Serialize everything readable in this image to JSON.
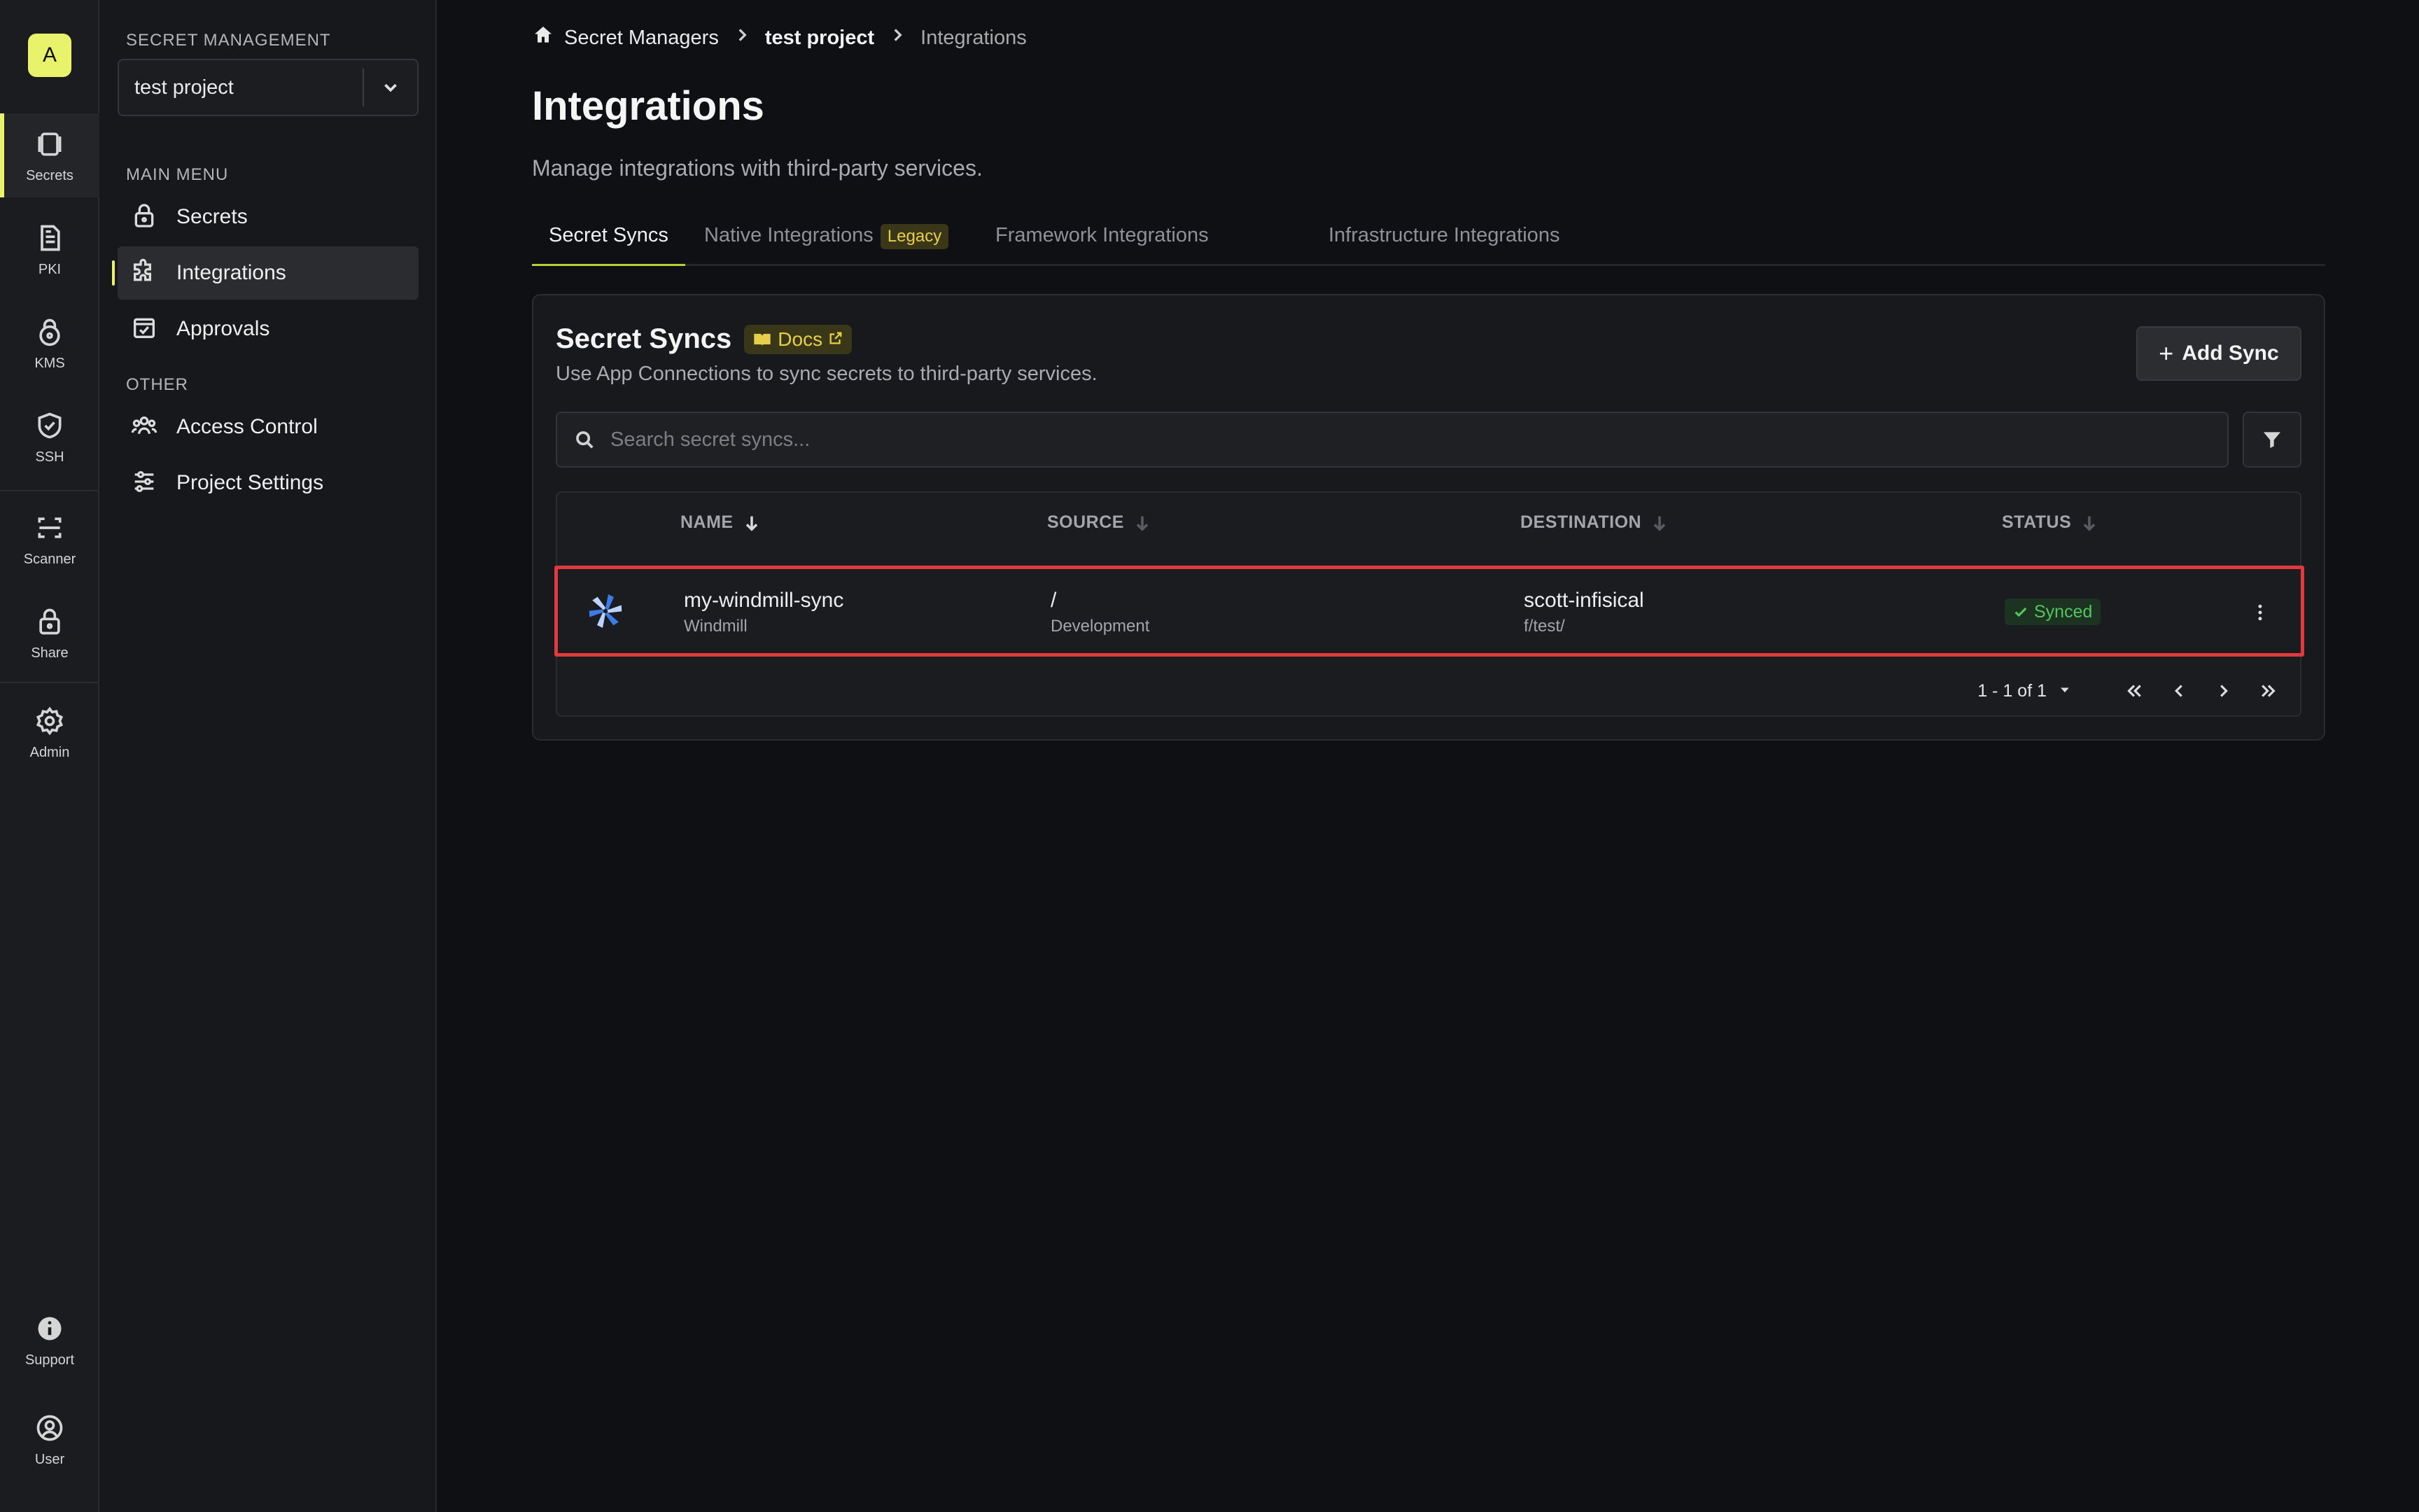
{
  "org": {
    "avatar_letter": "A"
  },
  "rail": {
    "items": [
      {
        "label": "Secrets",
        "icon": "secrets-icon"
      },
      {
        "label": "PKI",
        "icon": "pki-icon"
      },
      {
        "label": "KMS",
        "icon": "kms-icon"
      },
      {
        "label": "SSH",
        "icon": "ssh-icon"
      },
      {
        "label": "Scanner",
        "icon": "scanner-icon"
      },
      {
        "label": "Share",
        "icon": "share-icon"
      },
      {
        "label": "Admin",
        "icon": "gear-icon"
      },
      {
        "label": "Support",
        "icon": "info-icon"
      },
      {
        "label": "User",
        "icon": "user-icon"
      }
    ],
    "active": "Secrets",
    "accent_color": "#e8f26a"
  },
  "sidebar": {
    "section_title": "SECRET MANAGEMENT",
    "project_name": "test project",
    "main_menu_title": "MAIN MENU",
    "main_menu": [
      {
        "label": "Secrets",
        "icon": "lock-icon"
      },
      {
        "label": "Integrations",
        "icon": "puzzle-icon"
      },
      {
        "label": "Approvals",
        "icon": "approval-icon"
      }
    ],
    "other_title": "OTHER",
    "other_menu": [
      {
        "label": "Access Control",
        "icon": "users-icon"
      },
      {
        "label": "Project Settings",
        "icon": "sliders-icon"
      }
    ],
    "active": "Integrations"
  },
  "breadcrumb": {
    "items": [
      "Secret Managers",
      "test project",
      "Integrations"
    ]
  },
  "page": {
    "title": "Integrations",
    "subtitle": "Manage integrations with third-party services."
  },
  "tabs": {
    "items": [
      {
        "label": "Secret Syncs"
      },
      {
        "label": "Native Integrations",
        "badge": "Legacy"
      },
      {
        "label": "Framework Integrations"
      },
      {
        "label": "Infrastructure Integrations"
      }
    ],
    "active": "Secret Syncs"
  },
  "panel": {
    "title": "Secret Syncs",
    "docs_label": "Docs",
    "subtitle": "Use App Connections to sync secrets to third-party services.",
    "add_button": "Add Sync",
    "search_placeholder": "Search secret syncs..."
  },
  "table": {
    "columns": [
      "NAME",
      "SOURCE",
      "DESTINATION",
      "STATUS"
    ],
    "rows": [
      {
        "name": "my-windmill-sync",
        "service": "Windmill",
        "source_path": "/",
        "source_env": "Development",
        "destination": "scott-infisical",
        "destination_path": "f/test/",
        "status": "Synced",
        "logo": "windmill-logo"
      }
    ],
    "pagination": "1 - 1 of 1"
  },
  "colors": {
    "highlight_border": "#e0393e",
    "status_synced": "#54c45e",
    "badge_yellow": "#e8cf4a"
  }
}
